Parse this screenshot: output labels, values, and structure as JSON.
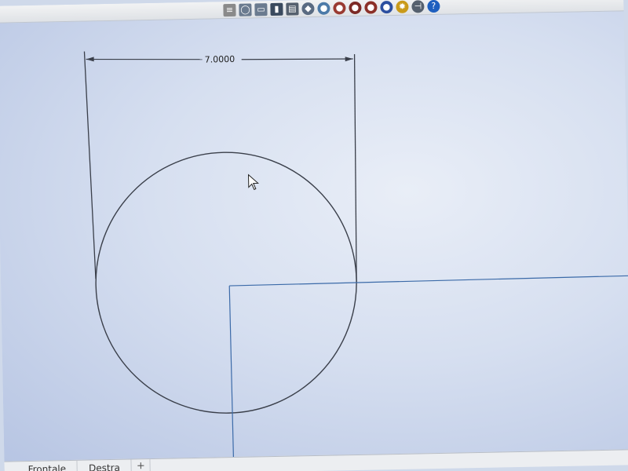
{
  "toolbar": {
    "icons": [
      {
        "name": "measure-icon",
        "glyph": "≡",
        "color": "#8a8a8a"
      },
      {
        "name": "circle-tool-icon",
        "glyph": "◯",
        "color": "#6b7b8f"
      },
      {
        "name": "copy-icon",
        "glyph": "▭",
        "color": "#6b7b8f"
      },
      {
        "name": "pin-icon",
        "glyph": "▮",
        "color": "#3a4a5e"
      },
      {
        "name": "document-icon",
        "glyph": "▤",
        "color": "#55606e"
      },
      {
        "name": "box-icon",
        "glyph": "◆",
        "color": "#5a6b82"
      },
      {
        "name": "sphere-icon",
        "glyph": "●",
        "color": "#4c7aa8"
      },
      {
        "name": "red-sphere-icon",
        "glyph": "●",
        "color": "#9a3b32"
      },
      {
        "name": "dark-red-sphere-icon",
        "glyph": "●",
        "color": "#7c2a26"
      },
      {
        "name": "cylinder-icon",
        "glyph": "●",
        "color": "#8c3028"
      },
      {
        "name": "blue-sphere-icon",
        "glyph": "●",
        "color": "#2c4fa0"
      },
      {
        "name": "gear-icon",
        "glyph": "✹",
        "color": "#c99a1a"
      },
      {
        "name": "connector-icon",
        "glyph": "⊣",
        "color": "#55606e"
      },
      {
        "name": "help-icon",
        "glyph": "?",
        "color": "#1e5fbf"
      }
    ]
  },
  "sketch": {
    "dimension_label": "7.0000",
    "line_color": "#3a3f4a",
    "axis_color": "#3b6aa8"
  },
  "tabs": {
    "items": [
      "Frontale",
      "Destra"
    ],
    "add_glyph": "+"
  }
}
